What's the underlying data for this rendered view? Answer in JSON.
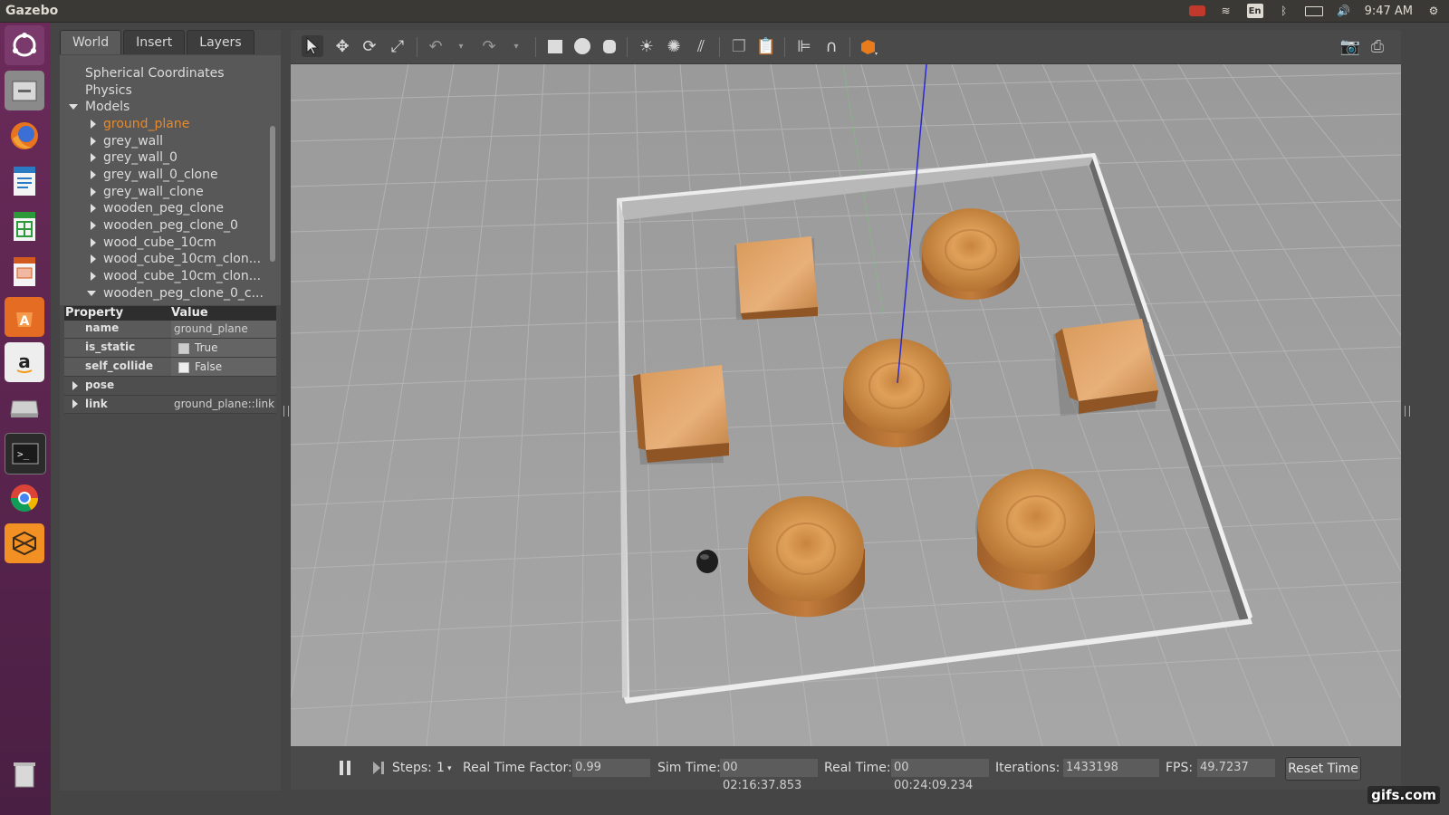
{
  "app": {
    "title": "Gazebo"
  },
  "tray": {
    "lang": "En",
    "time": "9:47 AM"
  },
  "tabs": [
    "World",
    "Insert",
    "Layers"
  ],
  "tree": {
    "items": [
      {
        "label": "Spherical Coordinates",
        "indent": 0,
        "arrow": "none"
      },
      {
        "label": "Physics",
        "indent": 0,
        "arrow": "none"
      },
      {
        "label": "Models",
        "indent": 0,
        "arrow": "down"
      },
      {
        "label": "ground_plane",
        "indent": 1,
        "arrow": "right",
        "selected": true
      },
      {
        "label": "grey_wall",
        "indent": 1,
        "arrow": "right"
      },
      {
        "label": "grey_wall_0",
        "indent": 1,
        "arrow": "right"
      },
      {
        "label": "grey_wall_0_clone",
        "indent": 1,
        "arrow": "right"
      },
      {
        "label": "grey_wall_clone",
        "indent": 1,
        "arrow": "right"
      },
      {
        "label": "wooden_peg_clone",
        "indent": 1,
        "arrow": "right"
      },
      {
        "label": "wooden_peg_clone_0",
        "indent": 1,
        "arrow": "right"
      },
      {
        "label": "wood_cube_10cm",
        "indent": 1,
        "arrow": "right"
      },
      {
        "label": "wood_cube_10cm_clon...",
        "indent": 1,
        "arrow": "right"
      },
      {
        "label": "wood_cube_10cm_clon...",
        "indent": 1,
        "arrow": "right"
      },
      {
        "label": "wooden_peg_clone_0_c...",
        "indent": 1,
        "arrow": "down"
      }
    ]
  },
  "props": {
    "header_property": "Property",
    "header_value": "Value",
    "name_label": "name",
    "name_value": "ground_plane",
    "is_static_label": "is_static",
    "is_static_value": "True",
    "self_collide_label": "self_collide",
    "self_collide_value": "False",
    "pose_label": "pose",
    "link_label": "link",
    "link_value": "ground_plane::link"
  },
  "bottom": {
    "steps_label": "Steps:",
    "steps_value": "1",
    "rtf_label": "Real Time Factor:",
    "rtf_value": "0.99",
    "sim_label": "Sim Time:",
    "sim_value": "00 02:16:37.853",
    "real_label": "Real Time:",
    "real_value": "00 00:24:09.234",
    "iter_label": "Iterations:",
    "iter_value": "1433198",
    "fps_label": "FPS:",
    "fps_value": "49.7237",
    "reset_label": "Reset Time"
  },
  "watermark": "gifs.com",
  "colors": {
    "selected": "#e88a2a",
    "launcher": "#5e2750",
    "wood": "#c8823c"
  },
  "icons": {
    "launcher": [
      "ubuntu-dash-icon",
      "files-icon",
      "firefox-icon",
      "writer-icon",
      "calc-icon",
      "impress-icon",
      "software-center-icon",
      "amazon-icon",
      "disk-icon",
      "terminal-icon",
      "chrome-icon",
      "gazebo-icon",
      "trash-icon"
    ],
    "toolbar": [
      "select-icon",
      "translate-icon",
      "rotate-icon",
      "scale-icon",
      "undo-icon",
      "undo-dropdown-icon",
      "redo-icon",
      "redo-dropdown-icon",
      "box-icon",
      "sphere-icon",
      "cylinder-icon",
      "point-light-icon",
      "spot-light-icon",
      "directional-light-icon",
      "copy-icon",
      "paste-icon",
      "align-icon",
      "snap-icon",
      "view-angle-icon",
      "screenshot-icon",
      "log-icon"
    ]
  }
}
